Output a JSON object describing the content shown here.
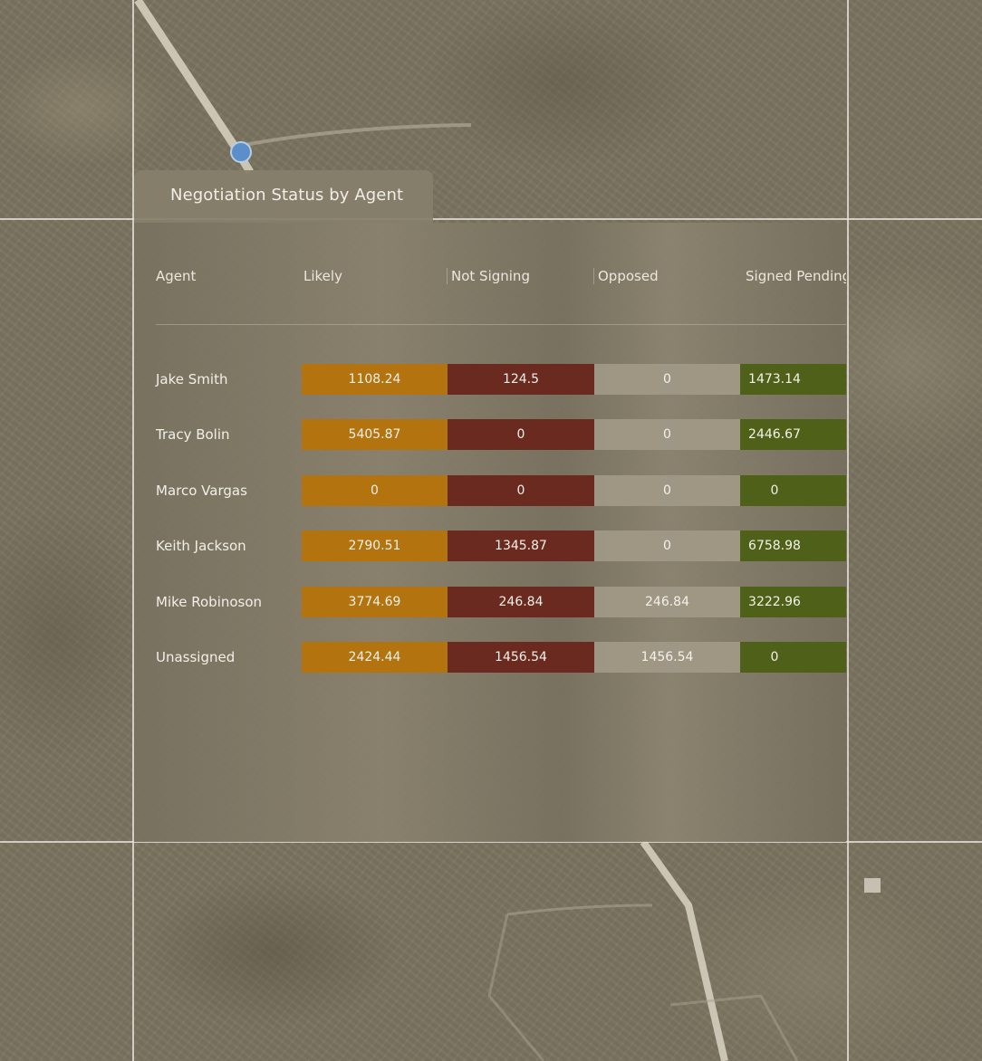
{
  "panel": {
    "title": "Negotiation Status by Agent"
  },
  "table": {
    "columns": [
      "Agent",
      "Likely",
      "Not Signing",
      "Opposed",
      "Signed Pending"
    ],
    "rows": [
      {
        "agent": "Jake Smith",
        "likely": "1108.24",
        "not_signing": "124.5",
        "opposed": "0",
        "signed_pending": "1473.14"
      },
      {
        "agent": "Tracy Bolin",
        "likely": "5405.87",
        "not_signing": "0",
        "opposed": "0",
        "signed_pending": "2446.67"
      },
      {
        "agent": "Marco Vargas",
        "likely": "0",
        "not_signing": "0",
        "opposed": "0",
        "signed_pending": "0"
      },
      {
        "agent": "Keith Jackson",
        "likely": "2790.51",
        "not_signing": "1345.87",
        "opposed": "0",
        "signed_pending": "6758.98"
      },
      {
        "agent": "Mike Robinoson",
        "likely": "3774.69",
        "not_signing": "246.84",
        "opposed": "246.84",
        "signed_pending": "3222.96"
      },
      {
        "agent": "Unassigned",
        "likely": "2424.44",
        "not_signing": "1456.54",
        "opposed": "1456.54",
        "signed_pending": "0"
      }
    ]
  },
  "colors": {
    "likely": "#b3730f",
    "not_signing": "#6b2a1f",
    "opposed": "#a09886",
    "signed_pending": "#4f6119"
  },
  "map": {
    "marker_icon": "map-pin-icon"
  }
}
